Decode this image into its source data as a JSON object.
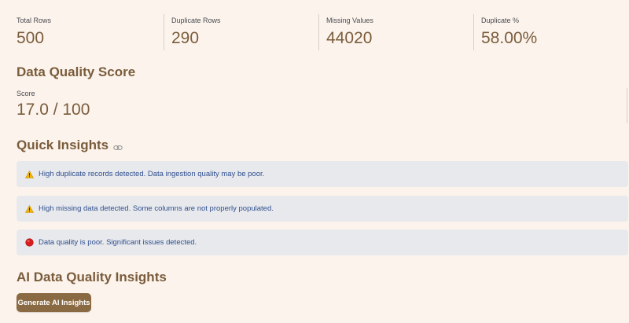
{
  "metrics": [
    {
      "label": "Total Rows",
      "value": "500"
    },
    {
      "label": "Duplicate Rows",
      "value": "290"
    },
    {
      "label": "Missing Values",
      "value": "44020"
    },
    {
      "label": "Duplicate %",
      "value": "58.00%"
    }
  ],
  "data_quality": {
    "heading": "Data Quality Score",
    "score_label": "Score",
    "score_value": "17.0 / 100"
  },
  "quick_insights": {
    "heading": "Quick Insights",
    "heading_icon": "link-icon",
    "alerts": [
      {
        "icon": "warning-icon",
        "text": "High duplicate records detected. Data ingestion quality may be poor."
      },
      {
        "icon": "warning-icon",
        "text": "High missing data detected. Some columns are not properly populated."
      },
      {
        "icon": "red-circle-icon",
        "text": "Data quality is poor. Significant issues detected."
      }
    ]
  },
  "ai_insights": {
    "heading": "AI Data Quality Insights",
    "button_label": "Generate AI Insights"
  },
  "colors": {
    "background": "#fcf4ec",
    "accent": "#7a5c3c",
    "button": "#8a6a42",
    "alert_bg": "#e8e9ec",
    "alert_text": "#2f4f8f"
  }
}
